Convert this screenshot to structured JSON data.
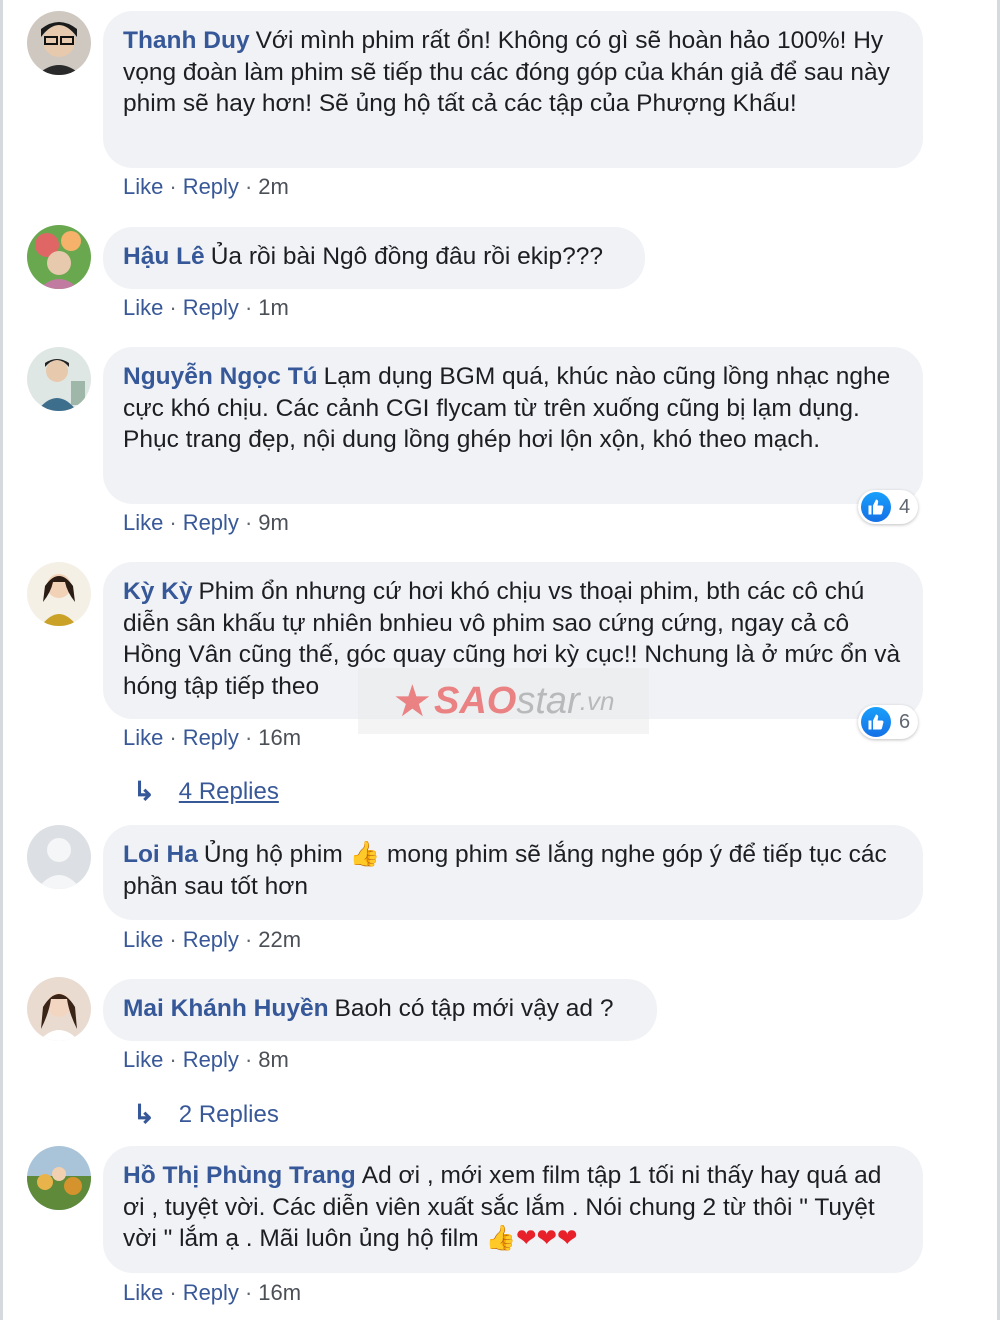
{
  "labels": {
    "like": "Like",
    "reply": "Reply",
    "sep": "·"
  },
  "comments": [
    {
      "author": "Thanh Duy",
      "text": "Với mình phim rất ổn! Không có gì sẽ hoàn hảo 100%! Hy vọng đoàn làm phim sẽ tiếp thu các đóng góp của khán giả để sau này phim sẽ hay hơn! Sẽ ủng hộ tất cả các tập của Phượng Khấu!",
      "time": "2m"
    },
    {
      "author": "Hậu Lê",
      "text": "Ủa rồi bài Ngô đồng đâu rồi ekip???",
      "time": "1m"
    },
    {
      "author": "Nguyễn Ngọc Tú",
      "text": "Lạm dụng BGM quá, khúc nào cũng lồng nhạc nghe cực khó chịu. Các cảnh CGI flycam từ trên xuống cũng bị lạm dụng. Phục trang đẹp, nội dung lồng ghép hơi lộn xộn, khó theo mạch.",
      "time": "9m",
      "reactions": "4"
    },
    {
      "author": "Kỳ Kỳ",
      "text": "Phim ổn nhưng cứ hơi khó chịu vs thoại phim, bth các cô chú diễn sân khấu tự nhiên bnhieu vô phim sao cứng cứng, ngay cả cô Hồng Vân cũng thế, góc quay cũng hơi kỳ cục!! Nchung là ở mức ổn và hóng tập tiếp theo",
      "time": "16m",
      "reactions": "6",
      "replies": "4 Replies"
    },
    {
      "author": "Loi Ha",
      "text_before": "Ủng hộ phim",
      "emoji": "👍",
      "text_after": "mong phim sẽ lắng nghe góp ý để tiếp tục các phần sau tốt hơn",
      "time": "22m"
    },
    {
      "author": "Mai Khánh Huyền",
      "text": "Baoh có tập mới vậy ad ?",
      "time": "8m",
      "replies": "2 Replies"
    },
    {
      "author": "Hồ Thị Phùng Trang",
      "text": "Ad ơi , mới xem film tập 1 tối ni thấy hay quá ad ơi , tuyệt vời. Các diễn viên xuất sắc lắm . Nói chung 2 từ thôi \" Tuyệt vời \" lắm ạ . Mãi luôn ủng hộ film",
      "emoji_thumb": "👍",
      "emoji_hearts": "❤❤❤",
      "time": "16m"
    }
  ],
  "watermark": {
    "star": "★",
    "sao": "SAO",
    "rest": "star",
    "tld": ".vn"
  },
  "colors": {
    "author": "#365899",
    "bubble": "#f0f2f5",
    "like_blue": "#1877f2",
    "watermark_red": "#e82828"
  },
  "icons": {
    "reaction": "thumbs-up-icon",
    "reply_arrow": "reply-arrow-icon"
  }
}
